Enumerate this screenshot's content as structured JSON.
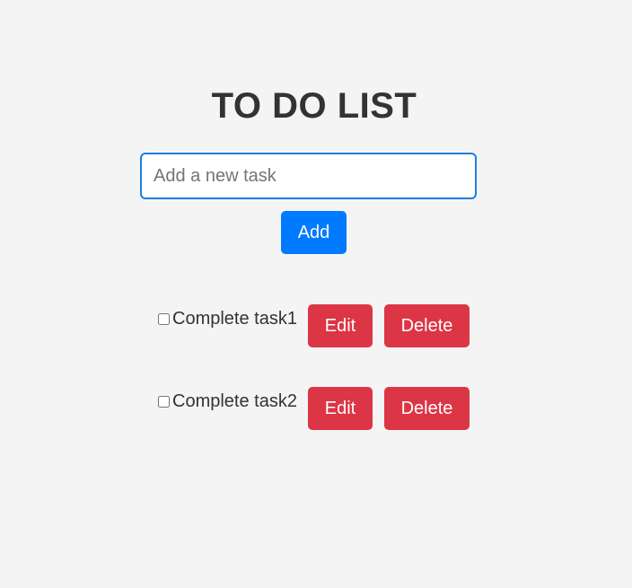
{
  "header": {
    "title": "TO DO LIST"
  },
  "new_task": {
    "value": "",
    "placeholder": "Add a new task",
    "add_label": "Add"
  },
  "tasks": [
    {
      "label": "Complete task1",
      "checked": false,
      "edit_label": "Edit",
      "delete_label": "Delete"
    },
    {
      "label": "Complete task2",
      "checked": false,
      "edit_label": "Edit",
      "delete_label": "Delete"
    }
  ],
  "colors": {
    "background": "#f4f4f4",
    "primary": "#007bff",
    "danger": "#dc3545",
    "text": "#333333",
    "input_border": "#1f7fe0"
  }
}
